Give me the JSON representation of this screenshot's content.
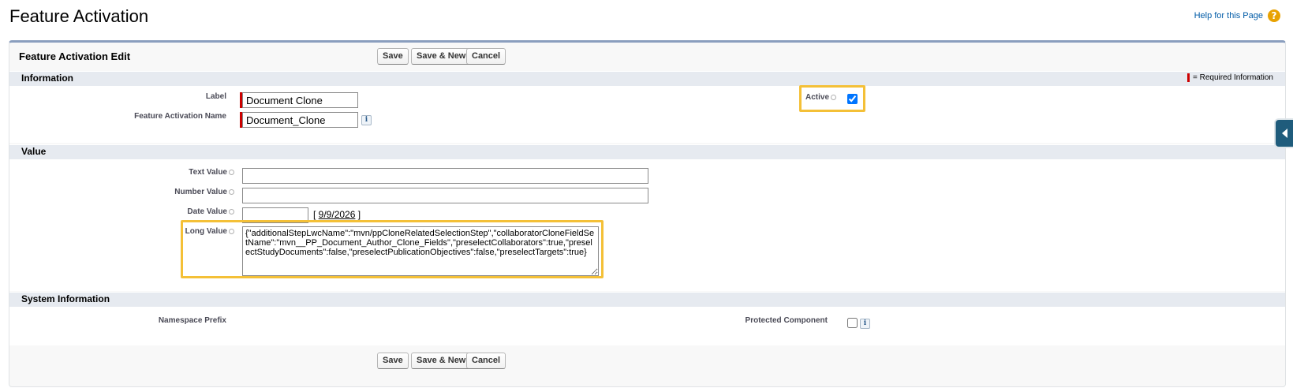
{
  "page": {
    "title": "Feature Activation",
    "help_link": "Help for this Page",
    "help_icon": "question-icon"
  },
  "panel": {
    "title": "Feature Activation Edit",
    "buttons": {
      "save": "Save",
      "save_new": "Save & New",
      "cancel": "Cancel"
    }
  },
  "sections": {
    "information": {
      "title": "Information",
      "required_legend": "= Required Information",
      "label_label": "Label",
      "label_value": "Document Clone",
      "name_label": "Feature Activation Name",
      "name_value": "Document_Clone",
      "active_label": "Active",
      "active_checked": true
    },
    "value": {
      "title": "Value",
      "text_label": "Text Value",
      "text_value": "",
      "number_label": "Number Value",
      "number_value": "",
      "date_label": "Date Value",
      "date_value": "",
      "date_today": "9/9/2026",
      "long_label": "Long Value",
      "long_value": "{\"additionalStepLwcName\":\"mvn/ppCloneRelatedSelectionStep\",\"collaboratorCloneFieldSetName\":\"mvn__PP_Document_Author_Clone_Fields\",\"preselectCollaborators\":true,\"preselectStudyDocuments\":false,\"preselectPublicationObjectives\":false,\"preselectTargets\":true}"
    },
    "system": {
      "title": "System Information",
      "namespace_label": "Namespace Prefix",
      "protected_label": "Protected Component",
      "protected_checked": false
    }
  },
  "colors": {
    "highlight": "#f4c037",
    "required": "#cc0000",
    "section_bg": "#e6eaf0",
    "link": "#015ba7"
  }
}
